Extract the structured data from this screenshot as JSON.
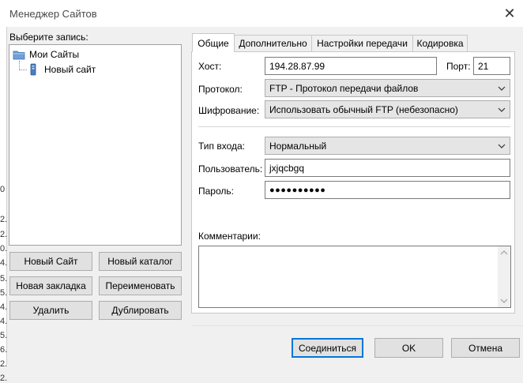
{
  "window": {
    "title": "Менеджер Сайтов",
    "close_glyph": "✕"
  },
  "left": {
    "select_label": "Выберите запись:",
    "tree": [
      {
        "label": "Мои Сайты",
        "icon": "folder-icon"
      },
      {
        "label": "Новый сайт",
        "icon": "server-icon"
      }
    ],
    "buttons": {
      "new_site": "Новый Сайт",
      "new_folder": "Новый каталог",
      "new_bookmark": "Новая закладка",
      "rename": "Переименовать",
      "delete": "Удалить",
      "duplicate": "Дублировать"
    }
  },
  "tabs": [
    {
      "label": "Общие",
      "active": true
    },
    {
      "label": "Дополнительно",
      "active": false
    },
    {
      "label": "Настройки передачи",
      "active": false
    },
    {
      "label": "Кодировка",
      "active": false
    }
  ],
  "general": {
    "host_label": "Хост:",
    "host_value": "194.28.87.99",
    "port_label": "Порт:",
    "port_value": "21",
    "protocol_label": "Протокол:",
    "protocol_value": "FTP - Протокол передачи файлов",
    "encryption_label": "Шифрование:",
    "encryption_value": "Использовать обычный FTP (небезопасно)",
    "logon_type_label": "Тип входа:",
    "logon_type_value": "Нормальный",
    "user_label": "Пользователь:",
    "user_value": "jxjqcbgq",
    "password_label": "Пароль:",
    "password_value": "●●●●●●●●●●",
    "comments_label": "Комментарии:"
  },
  "footer": {
    "connect": "Соединиться",
    "ok": "OK",
    "cancel": "Отмена"
  },
  "background_edge": [
    "0",
    "2.",
    "2.",
    "0.",
    "4.",
    "5.",
    "5.",
    "4.",
    "4.",
    "5.",
    "6.",
    "2.",
    "2."
  ]
}
